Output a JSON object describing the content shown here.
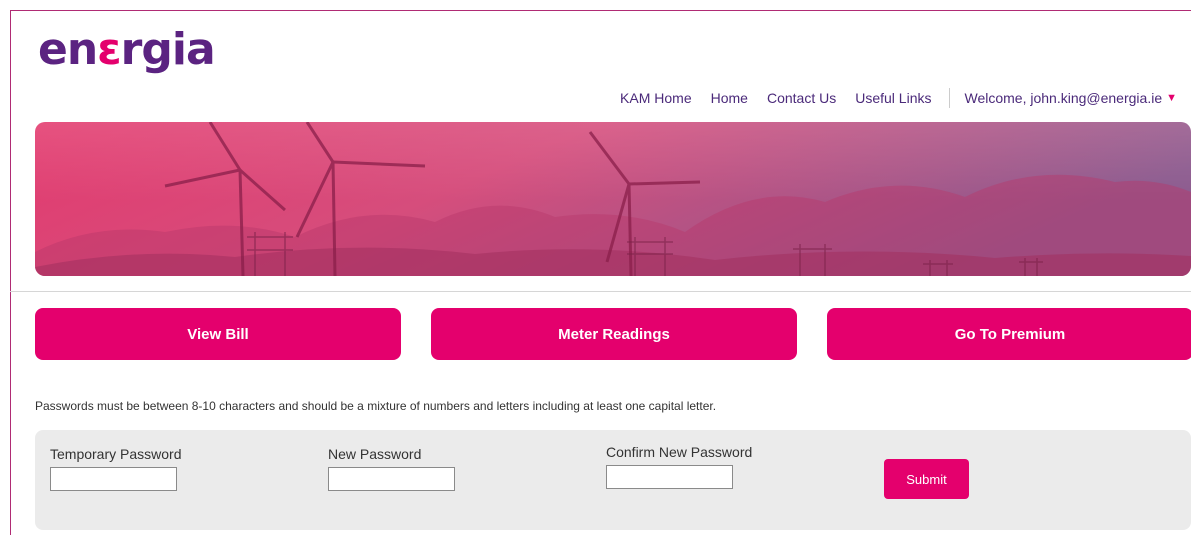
{
  "brand": {
    "logo_main": "en",
    "logo_accent": "ε",
    "logo_rest": "rgia",
    "primary_color": "#5b2381",
    "accent_color": "#e4006d"
  },
  "nav": {
    "items": [
      {
        "label": "KAM Home"
      },
      {
        "label": "Home"
      },
      {
        "label": "Contact Us"
      },
      {
        "label": "Useful Links"
      }
    ],
    "welcome_prefix": "Welcome, ",
    "user_email": "john.king@energia.ie",
    "caret_icon": "caret-down-icon"
  },
  "actions": [
    {
      "label": "View Bill"
    },
    {
      "label": "Meter Readings"
    },
    {
      "label": "Go To Premium"
    }
  ],
  "password_notice": "Passwords must be between 8-10 characters and should be a mixture of numbers and letters including at least one capital letter.",
  "form": {
    "fields": [
      {
        "label": "Temporary Password",
        "value": ""
      },
      {
        "label": "New Password",
        "value": ""
      },
      {
        "label": "Confirm New Password",
        "value": ""
      }
    ],
    "submit_label": "Submit"
  }
}
